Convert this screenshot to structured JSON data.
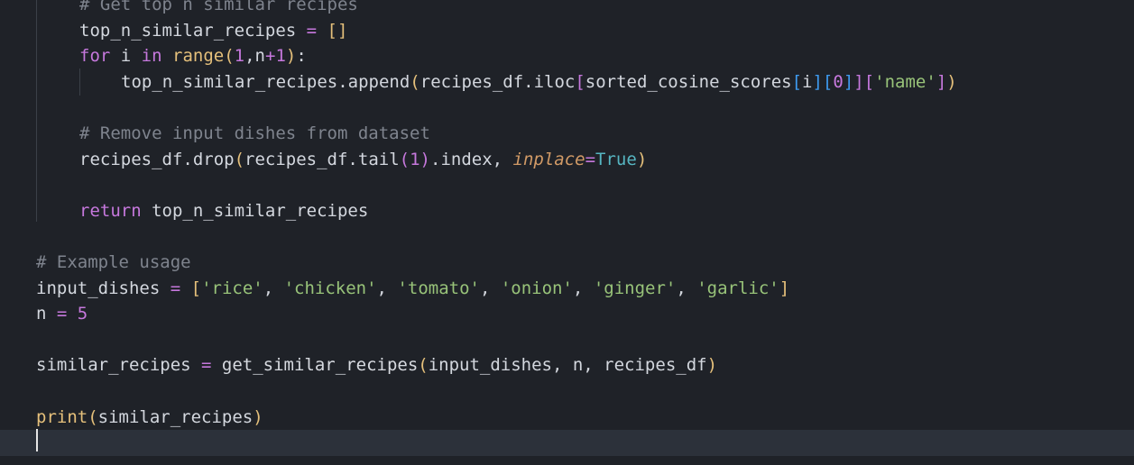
{
  "editor": {
    "lines": [
      {
        "indent": 88,
        "tokens": [
          {
            "t": "# Get top n similar recipes",
            "c": "comment"
          }
        ]
      },
      {
        "indent": 88,
        "tokens": [
          {
            "t": "top_n_similar_recipes",
            "c": "var"
          },
          {
            "t": " = ",
            "c": "op"
          },
          {
            "t": "[]",
            "c": "br1"
          }
        ]
      },
      {
        "indent": 88,
        "tokens": [
          {
            "t": "for",
            "c": "keyword"
          },
          {
            "t": " i ",
            "c": "var"
          },
          {
            "t": "in",
            "c": "keyword"
          },
          {
            "t": " ",
            "c": "var"
          },
          {
            "t": "range",
            "c": "builtin"
          },
          {
            "t": "(",
            "c": "br1"
          },
          {
            "t": "1",
            "c": "num"
          },
          {
            "t": ",n",
            "c": "var"
          },
          {
            "t": "+",
            "c": "op"
          },
          {
            "t": "1",
            "c": "num"
          },
          {
            "t": ")",
            "c": "br1"
          },
          {
            "t": ":",
            "c": "var"
          }
        ]
      },
      {
        "indent": 134,
        "tokens": [
          {
            "t": "top_n_similar_recipes.append",
            "c": "var"
          },
          {
            "t": "(",
            "c": "br1"
          },
          {
            "t": "recipes_df.iloc",
            "c": "var"
          },
          {
            "t": "[",
            "c": "br2"
          },
          {
            "t": "sorted_cosine_scores",
            "c": "var"
          },
          {
            "t": "[",
            "c": "br3"
          },
          {
            "t": "i",
            "c": "var"
          },
          {
            "t": "][",
            "c": "br3"
          },
          {
            "t": "0",
            "c": "num"
          },
          {
            "t": "]",
            "c": "br3"
          },
          {
            "t": "][",
            "c": "br2"
          },
          {
            "t": "'name'",
            "c": "string"
          },
          {
            "t": "]",
            "c": "br2"
          },
          {
            "t": ")",
            "c": "br1"
          }
        ]
      },
      {
        "indent": 88,
        "tokens": []
      },
      {
        "indent": 88,
        "tokens": [
          {
            "t": "# Remove input dishes from dataset",
            "c": "comment"
          }
        ]
      },
      {
        "indent": 88,
        "tokens": [
          {
            "t": "recipes_df.drop",
            "c": "var"
          },
          {
            "t": "(",
            "c": "br1"
          },
          {
            "t": "recipes_df.tail",
            "c": "var"
          },
          {
            "t": "(",
            "c": "br2"
          },
          {
            "t": "1",
            "c": "num"
          },
          {
            "t": ")",
            "c": "br2"
          },
          {
            "t": ".index, ",
            "c": "var"
          },
          {
            "t": "inplace",
            "c": "param"
          },
          {
            "t": "=",
            "c": "op"
          },
          {
            "t": "True",
            "c": "const"
          },
          {
            "t": ")",
            "c": "br1"
          }
        ]
      },
      {
        "indent": 88,
        "tokens": []
      },
      {
        "indent": 88,
        "tokens": [
          {
            "t": "return",
            "c": "keyword"
          },
          {
            "t": " top_n_similar_recipes",
            "c": "var"
          }
        ]
      },
      {
        "indent": 40,
        "tokens": []
      },
      {
        "indent": 40,
        "tokens": [
          {
            "t": "# Example usage",
            "c": "comment"
          }
        ]
      },
      {
        "indent": 40,
        "tokens": [
          {
            "t": "input_dishes",
            "c": "var"
          },
          {
            "t": " = ",
            "c": "op"
          },
          {
            "t": "[",
            "c": "br1"
          },
          {
            "t": "'rice'",
            "c": "string"
          },
          {
            "t": ", ",
            "c": "var"
          },
          {
            "t": "'chicken'",
            "c": "string"
          },
          {
            "t": ", ",
            "c": "var"
          },
          {
            "t": "'tomato'",
            "c": "string"
          },
          {
            "t": ", ",
            "c": "var"
          },
          {
            "t": "'onion'",
            "c": "string"
          },
          {
            "t": ", ",
            "c": "var"
          },
          {
            "t": "'ginger'",
            "c": "string"
          },
          {
            "t": ", ",
            "c": "var"
          },
          {
            "t": "'garlic'",
            "c": "string"
          },
          {
            "t": "]",
            "c": "br1"
          }
        ]
      },
      {
        "indent": 40,
        "tokens": [
          {
            "t": "n",
            "c": "var"
          },
          {
            "t": " = ",
            "c": "op"
          },
          {
            "t": "5",
            "c": "num"
          }
        ]
      },
      {
        "indent": 40,
        "tokens": []
      },
      {
        "indent": 40,
        "tokens": [
          {
            "t": "similar_recipes",
            "c": "var"
          },
          {
            "t": " = ",
            "c": "op"
          },
          {
            "t": "get_similar_recipes",
            "c": "func"
          },
          {
            "t": "(",
            "c": "br1"
          },
          {
            "t": "input_dishes, n, recipes_df",
            "c": "var"
          },
          {
            "t": ")",
            "c": "br1"
          }
        ]
      },
      {
        "indent": 40,
        "tokens": []
      },
      {
        "indent": 40,
        "tokens": [
          {
            "t": "print",
            "c": "builtin"
          },
          {
            "t": "(",
            "c": "br1"
          },
          {
            "t": "similar_recipes",
            "c": "var"
          },
          {
            "t": ")",
            "c": "br1"
          }
        ]
      },
      {
        "indent": 40,
        "tokens": [],
        "current": true
      }
    ]
  }
}
